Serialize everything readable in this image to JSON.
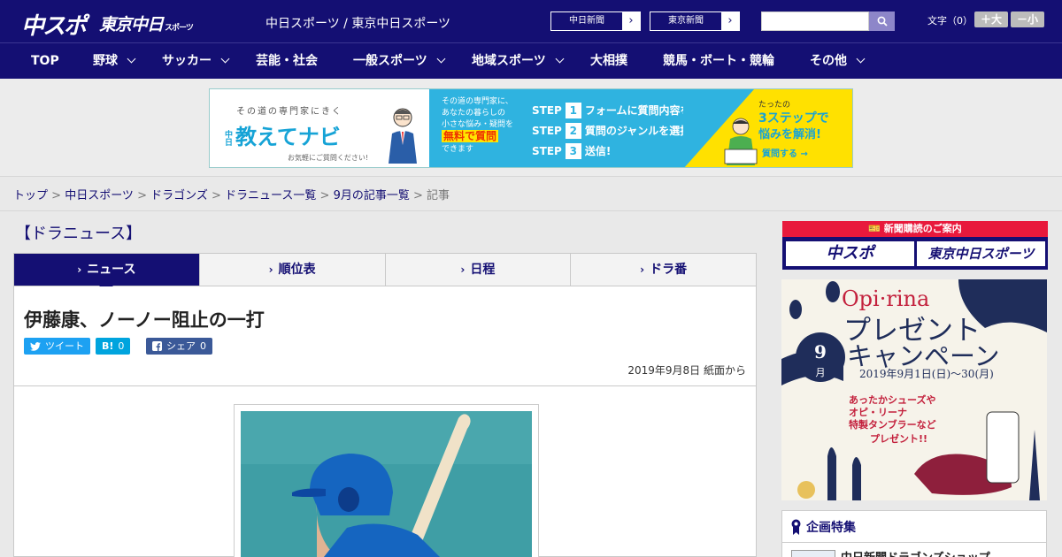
{
  "header": {
    "logo_chuspo": "中スポ",
    "logo_tokyo": "東京中日",
    "logo_tokyo_sub": "スポーツ",
    "site_names": "中日スポーツ / 東京中日スポーツ",
    "paper_buttons": [
      "中日新聞",
      "東京新聞"
    ],
    "search_placeholder": "",
    "font_size_label": "文字（0）",
    "font_plus": "＋大",
    "font_minus": "－小"
  },
  "nav": {
    "items": [
      "TOP",
      "野球",
      "サッカー",
      "芸能・社会",
      "一般スポーツ",
      "地域スポーツ",
      "大相撲",
      "競馬・ボート・競輪",
      "その他"
    ]
  },
  "banner": {
    "tagline": "その道の専門家にきく",
    "title_prefix": "中日",
    "title": "教えてナビ",
    "note": "お気軽にご質問ください!",
    "desc_lines": [
      "その道の専門家に、",
      "あなたの暮らしの",
      "小さな悩み・疑問を"
    ],
    "desc_em": "無料で質問",
    "desc_end": "できます",
    "steps": [
      {
        "label": "STEP",
        "num": "1",
        "text": "フォームに質問内容を入力"
      },
      {
        "label": "STEP",
        "num": "2",
        "text": "質問のジャンルを選択"
      },
      {
        "label": "STEP",
        "num": "3",
        "text": "送信!"
      }
    ],
    "right_small": "たったの",
    "right_big": "3ステップで",
    "right_big2": "悩みを解消!",
    "right_cta": "質問する →"
  },
  "breadcrumb": {
    "links": [
      "トップ",
      "中日スポーツ",
      "ドラゴンズ",
      "ドラニュース一覧",
      "9月の記事一覧"
    ],
    "separator": " > ",
    "current": "記事"
  },
  "section_title": "【ドラニュース】",
  "tabs": [
    {
      "label": "ニュース"
    },
    {
      "label": "順位表"
    },
    {
      "label": "日程"
    },
    {
      "label": "ドラ番"
    }
  ],
  "article": {
    "headline": "伊藤康、ノーノー阻止の一打",
    "share": {
      "tweet": "ツイート",
      "hatena_label": "B!",
      "hatena_count": "0",
      "fb_label": "シェア",
      "fb_count": "0"
    },
    "dateline": "2019年9月8日 紙面から"
  },
  "sidebar": {
    "subscription_title": "新聞購読のご案内",
    "sub_logos": [
      "中スポ",
      "東京中日スポーツ"
    ],
    "campaign": {
      "brand": "Opi·rina",
      "title1": "プレゼント",
      "title2": "キャンペーン",
      "period": "2019年9月1日(日)〜30(月)",
      "month_num": "9",
      "month_unit": "月",
      "lines": [
        "あったかシューズや",
        "オピ・リーナ",
        "特製タンブラーなど",
        "プレゼント!!"
      ]
    },
    "feature_title": "企画特集",
    "feature_item": "中日新聞ドラゴンズショップ"
  },
  "colors": {
    "brand_navy": "#140f73",
    "accent_red": "#e8193c",
    "banner_blue": "#2fb3e0",
    "banner_yellow": "#ffe100"
  }
}
